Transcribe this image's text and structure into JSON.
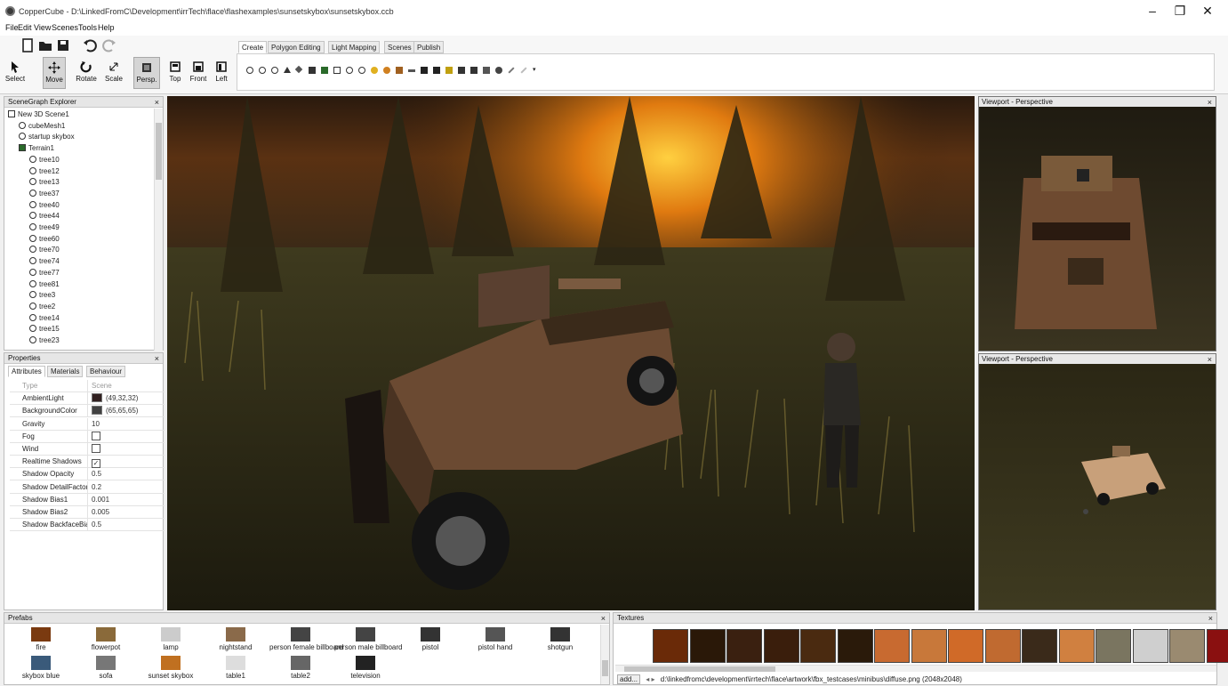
{
  "window": {
    "title": "CopperCube - D:\\LinkedFromC\\Development\\irrTech\\flace\\flashexamples\\sunsetskybox\\sunsetskybox.ccb",
    "minimize": "–",
    "maximize": "❐",
    "close": "✕"
  },
  "menu": [
    "File",
    "Edit",
    "View",
    "Scenes",
    "Tools",
    "Help"
  ],
  "tools": [
    {
      "label": "Select",
      "icon": "arrow-cursor-icon"
    },
    {
      "label": "Move",
      "icon": "move-arrows-icon",
      "active": true
    },
    {
      "label": "Rotate",
      "icon": "rotate-icon"
    },
    {
      "label": "Scale",
      "icon": "scale-icon"
    },
    {
      "label": "Persp.",
      "icon": "perspective-icon",
      "active": true
    },
    {
      "label": "Top",
      "icon": "top-view-icon"
    },
    {
      "label": "Front",
      "icon": "front-view-icon"
    },
    {
      "label": "Left",
      "icon": "left-view-icon"
    }
  ],
  "ribbon_tabs": [
    "Create",
    "Polygon Editing",
    "Light Mapping",
    "Scenes",
    "Publish"
  ],
  "scenegraph": {
    "title": "SceneGraph Explorer",
    "close": "×",
    "items": [
      {
        "label": "New 3D Scene1",
        "level": 0
      },
      {
        "label": "cubeMesh1",
        "level": 1
      },
      {
        "label": "startup skybox",
        "level": 1
      },
      {
        "label": "Terrain1",
        "level": 1
      },
      {
        "label": "tree10",
        "level": 2
      },
      {
        "label": "tree12",
        "level": 2
      },
      {
        "label": "tree13",
        "level": 2
      },
      {
        "label": "tree37",
        "level": 2
      },
      {
        "label": "tree40",
        "level": 2
      },
      {
        "label": "tree44",
        "level": 2
      },
      {
        "label": "tree49",
        "level": 2
      },
      {
        "label": "tree60",
        "level": 2
      },
      {
        "label": "tree70",
        "level": 2
      },
      {
        "label": "tree74",
        "level": 2
      },
      {
        "label": "tree77",
        "level": 2
      },
      {
        "label": "tree81",
        "level": 2
      },
      {
        "label": "tree3",
        "level": 2
      },
      {
        "label": "tree2",
        "level": 2
      },
      {
        "label": "tree14",
        "level": 2
      },
      {
        "label": "tree15",
        "level": 2
      },
      {
        "label": "tree23",
        "level": 2
      }
    ]
  },
  "properties": {
    "title": "Properties",
    "close": "×",
    "tabs": [
      "Attributes",
      "Materials",
      "Behaviour"
    ],
    "rows": [
      {
        "key": "Type",
        "value": "Scene",
        "kind": "text",
        "dim": true
      },
      {
        "key": "AmbientLight",
        "value": "(49,32,32)",
        "kind": "color",
        "color": "#312020"
      },
      {
        "key": "BackgroundColor",
        "value": "(65,65,65)",
        "kind": "color",
        "color": "#414141"
      },
      {
        "key": "Gravity",
        "value": "10",
        "kind": "text"
      },
      {
        "key": "Fog",
        "value": "",
        "kind": "check",
        "checked": false
      },
      {
        "key": "Wind",
        "value": "",
        "kind": "check",
        "checked": false
      },
      {
        "key": "Realtime Shadows",
        "value": "",
        "kind": "check",
        "checked": true
      },
      {
        "key": "Shadow Opacity",
        "value": "0.5",
        "kind": "text"
      },
      {
        "key": "Shadow DetailFactor",
        "value": "0.2",
        "kind": "text"
      },
      {
        "key": "Shadow Bias1",
        "value": "0.001",
        "kind": "text"
      },
      {
        "key": "Shadow Bias2",
        "value": "0.005",
        "kind": "text"
      },
      {
        "key": "Shadow BackfaceBias",
        "value": "0.5",
        "kind": "text"
      }
    ]
  },
  "viewports": {
    "top_title": "Viewport - Perspective",
    "bottom_title": "Viewport - Perspective",
    "close": "×"
  },
  "prefabs": {
    "title": "Prefabs",
    "close": "×",
    "items": [
      {
        "label": "fire",
        "color": "#7a3a10"
      },
      {
        "label": "flowerpot",
        "color": "#8a6a3a"
      },
      {
        "label": "lamp",
        "color": "#cccccc"
      },
      {
        "label": "nightstand",
        "color": "#8a6a4a"
      },
      {
        "label": "person female billboard",
        "color": "#444444"
      },
      {
        "label": "person male billboard",
        "color": "#444444"
      },
      {
        "label": "pistol",
        "color": "#333333"
      },
      {
        "label": "pistol hand",
        "color": "#555555"
      },
      {
        "label": "shotgun",
        "color": "#333333"
      },
      {
        "label": "skybox blue",
        "color": "#3a5a7a"
      },
      {
        "label": "sofa",
        "color": "#777777"
      },
      {
        "label": "sunset skybox",
        "color": "#c07020"
      },
      {
        "label": "table1",
        "color": "#dddddd"
      },
      {
        "label": "table2",
        "color": "#666666"
      },
      {
        "label": "television",
        "color": "#222222"
      }
    ]
  },
  "textures": {
    "title": "Textures",
    "close": "×",
    "add_label": "add...",
    "path": "d:\\linkedfromc\\development\\irrtech\\flace\\artwork\\fbx_testcases\\minibus\\diffuse.png (2048x2048)",
    "swatches": [
      "#6a2a08",
      "#2a1808",
      "#3a2010",
      "#3a1e0c",
      "#4a2a10",
      "#2a1a0a",
      "#c86a30",
      "#c8783a",
      "#d06a28",
      "#c06a30",
      "#3a2a1a",
      "#d08040",
      "#7a7560",
      "#cfcfcf",
      "#9a8a70",
      "#8a1010"
    ]
  },
  "colors": {
    "accent": "#d5d5d5",
    "panel_header": "#e6e6e6",
    "sunset": "#e07a10"
  }
}
